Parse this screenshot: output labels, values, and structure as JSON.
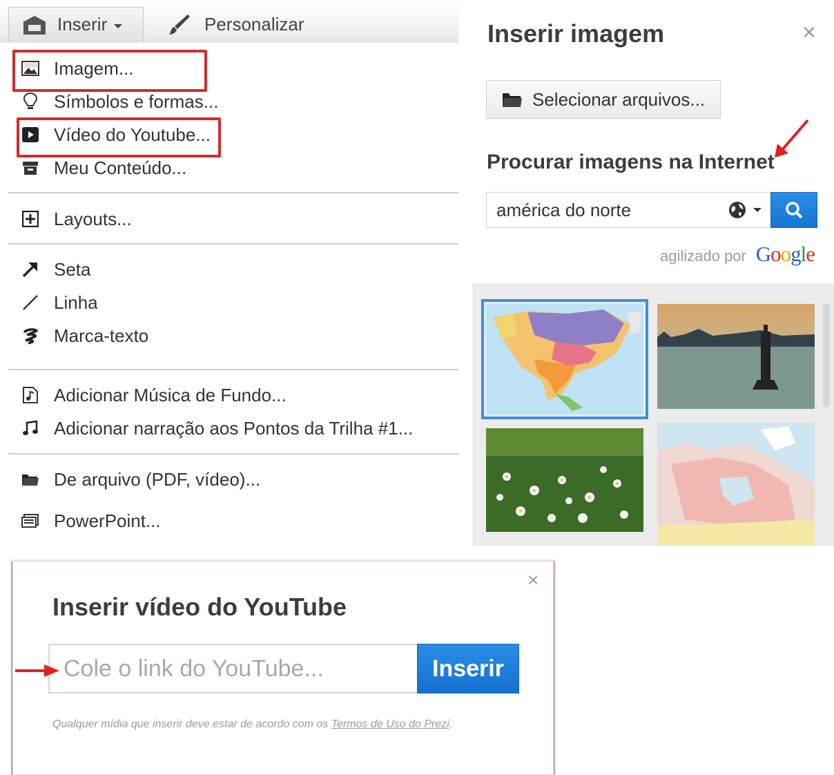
{
  "toolbar": {
    "insert_label": "Inserir",
    "customize_label": "Personalizar"
  },
  "menu": {
    "items": [
      {
        "label": "Imagem...",
        "icon": "image-icon"
      },
      {
        "label": "Símbolos e formas...",
        "icon": "lightbulb-icon"
      },
      {
        "label": "Vídeo do Youtube...",
        "icon": "video-play-icon"
      },
      {
        "label": "Meu Conteúdo...",
        "icon": "archive-box-icon"
      },
      {
        "label": "Layouts...",
        "icon": "plus-box-icon"
      },
      {
        "label": "Seta",
        "icon": "arrow-icon"
      },
      {
        "label": "Linha",
        "icon": "line-icon"
      },
      {
        "label": "Marca-texto",
        "icon": "highlighter-icon"
      },
      {
        "label": "Adicionar Música de Fundo...",
        "icon": "music-file-icon"
      },
      {
        "label": "Adicionar narração aos Pontos da Trilha #1...",
        "icon": "music-note-icon"
      },
      {
        "label": "De arquivo (PDF, vídeo)...",
        "icon": "folder-icon"
      },
      {
        "label": "PowerPoint...",
        "icon": "slides-icon"
      }
    ]
  },
  "image_panel": {
    "title": "Inserir imagem",
    "close": "×",
    "select_files_label": "Selecionar arquivos...",
    "search_heading": "Procurar imagens na Internet",
    "search_value": "américa do norte",
    "powered_by": "agilizado por",
    "google_logo": "Google"
  },
  "youtube_dialog": {
    "title": "Inserir vídeo do YouTube",
    "close": "×",
    "input_placeholder": "Cole o link do YouTube...",
    "insert_label": "Inserir",
    "disclaimer_prefix": "Qualquer mídia que inserir deve estar de acordo com os ",
    "terms_link": "Termos de Uso do Prezi",
    "disclaimer_suffix": "."
  },
  "colors": {
    "highlight_red": "#d42a2a",
    "accent_blue": "#1f80dc",
    "selection_blue": "#3d8fe0"
  }
}
